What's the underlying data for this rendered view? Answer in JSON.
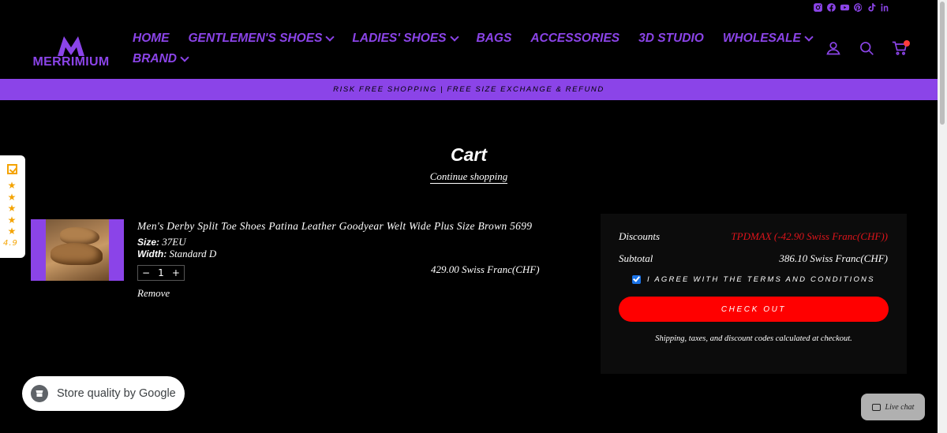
{
  "brand": {
    "name": "MERRIMIUM",
    "accent": "#8b44e8"
  },
  "social_icons": [
    "instagram-icon",
    "facebook-icon",
    "youtube-icon",
    "pinterest-icon",
    "tiktok-icon",
    "linkedin-icon"
  ],
  "nav": {
    "items": [
      {
        "label": "HOME",
        "dropdown": false
      },
      {
        "label": "GENTLEMEN'S SHOES",
        "dropdown": true
      },
      {
        "label": "LADIES' SHOES",
        "dropdown": true
      },
      {
        "label": "BAGS",
        "dropdown": false
      },
      {
        "label": "ACCESSORIES",
        "dropdown": false
      },
      {
        "label": "3D STUDIO",
        "dropdown": false
      },
      {
        "label": "WHOLESALE",
        "dropdown": true
      },
      {
        "label": "BRAND",
        "dropdown": true
      }
    ]
  },
  "header_icons": [
    "account-icon",
    "search-icon",
    "cart-icon"
  ],
  "announcement": "RISK FREE SHOPPING | FREE SIZE EXCHANGE & REFUND",
  "cart": {
    "title": "Cart",
    "continue_label": "Continue shopping",
    "item": {
      "name": "Men's Derby Split Toe Shoes Patina Leather Goodyear Welt Wide Plus Size Brown 5699",
      "size_label": "Size:",
      "size_value": "37EU",
      "width_label": "Width:",
      "width_value": "Standard D",
      "quantity": "1",
      "minus": "−",
      "plus": "+",
      "remove_label": "Remove",
      "price": "429.00 Swiss Franc(CHF)"
    }
  },
  "reviews_badge": {
    "rating": "4.9"
  },
  "summary": {
    "discounts_label": "Discounts",
    "discounts_value": "TPDMAX (-42.90 Swiss Franc(CHF))",
    "subtotal_label": "Subtotal",
    "subtotal_value": "386.10 Swiss Franc(CHF)",
    "agree_label": "I AGREE WITH THE TERMS AND CONDITIONS",
    "agree_checked": true,
    "checkout_label": "CHECK OUT",
    "note": "Shipping, taxes, and discount codes calculated at checkout.",
    "discount_color": "#e0141b",
    "checkout_color": "#ff0000"
  },
  "google_badge": {
    "label": "Store quality by Google"
  },
  "chat": {
    "label": "Live chat"
  }
}
